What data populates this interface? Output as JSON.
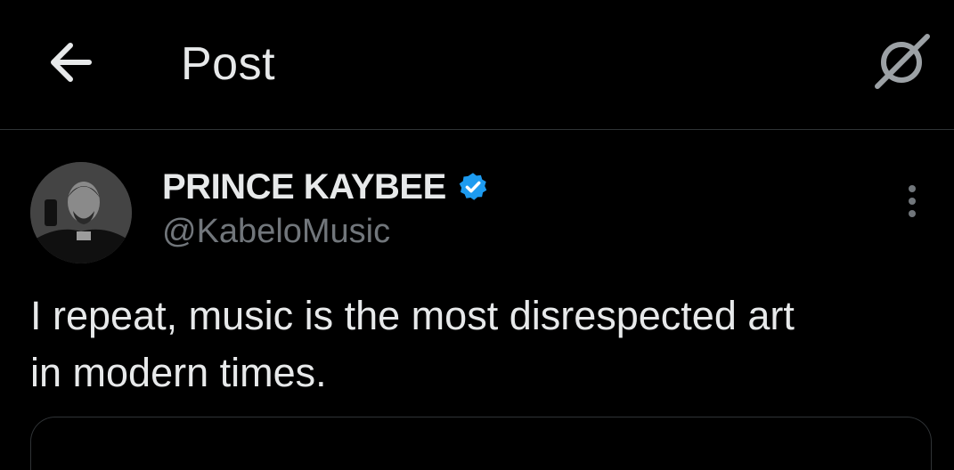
{
  "header": {
    "title": "Post",
    "back_icon": "arrow-left-icon",
    "grok_icon": "grok-icon"
  },
  "post": {
    "author": {
      "display_name": "PRINCE KAYBEE",
      "handle": "@KabeloMusic",
      "verified": true,
      "verified_color": "#1d9bf0"
    },
    "text": "I repeat, music is the most disrespected art\nin modern times.",
    "more_icon": "more-vertical-icon"
  },
  "colors": {
    "background": "#000000",
    "text_primary": "#e7e9ea",
    "text_secondary": "#71767b",
    "divider": "#2f3336"
  }
}
